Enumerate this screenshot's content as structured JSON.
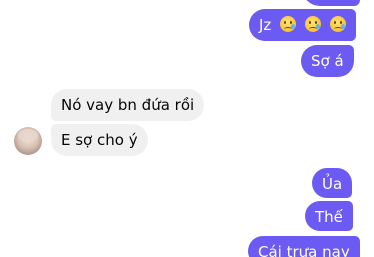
{
  "messages": {
    "sent_top_partial": "",
    "jz": "Jz",
    "jz_emojis": [
      "crying-face-emoji",
      "crying-face-emoji",
      "crying-face-emoji"
    ],
    "so_a": "Sợ á",
    "recv_1": "Nó vay bn đứa rồi",
    "recv_2": "E sợ cho ý",
    "ua": "Ủa",
    "the": "Thế",
    "cai_trua_nay": "Cái trưa nay"
  },
  "colors": {
    "sent_bubble": "#6b5bf2",
    "received_bubble": "#f0f0f0",
    "background": "#ffffff"
  }
}
